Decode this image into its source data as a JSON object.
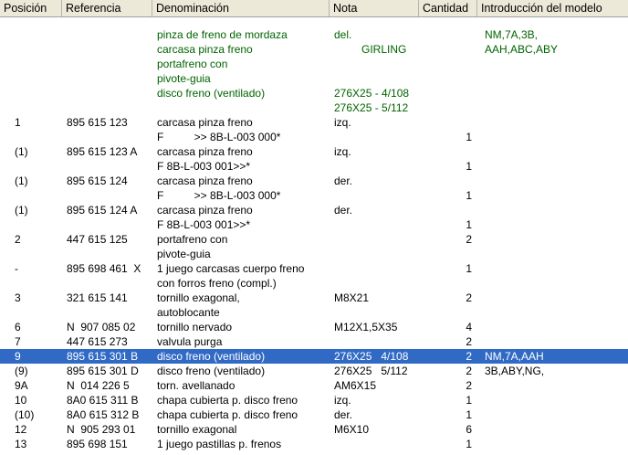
{
  "columns": [
    "Posición",
    "Referencia",
    "Denominación",
    "Nota",
    "Cantidad",
    "Introducción del modelo"
  ],
  "selected_row": 18,
  "colors": {
    "group_text": "#006400",
    "selection": "#316ac5",
    "header_bg": "#ece9d8"
  },
  "rows": [
    {
      "pos": "",
      "ref": "",
      "den": "pinza de freno de mordaza",
      "nota": "del.",
      "cant": "",
      "intro": "NM,7A,3B,",
      "group": true
    },
    {
      "pos": "",
      "ref": "",
      "den": "carcasa pinza freno",
      "nota": "         GIRLING",
      "cant": "",
      "intro": "AAH,ABC,ABY",
      "group": true
    },
    {
      "pos": "",
      "ref": "",
      "den": "portafreno con",
      "nota": "",
      "cant": "",
      "intro": "",
      "group": true
    },
    {
      "pos": "",
      "ref": "",
      "den": "pivote-guia",
      "nota": "",
      "cant": "",
      "intro": "",
      "group": true
    },
    {
      "pos": "",
      "ref": "",
      "den": "disco freno (ventilado)",
      "nota": "276X25 - 4/108",
      "cant": "",
      "intro": "",
      "group": true
    },
    {
      "pos": "",
      "ref": "",
      "den": "",
      "nota": "276X25 - 5/112",
      "cant": "",
      "intro": "",
      "group": true
    },
    {
      "pos": "1",
      "ref": "895 615 123",
      "den": "carcasa pinza freno",
      "nota": "izq.",
      "cant": "",
      "intro": ""
    },
    {
      "pos": "",
      "ref": "",
      "den": "F          >> 8B-L-003 000*",
      "nota": "",
      "cant": "1",
      "intro": ""
    },
    {
      "pos": "(1)",
      "ref": "895 615 123 A",
      "den": "carcasa pinza freno",
      "nota": "izq.",
      "cant": "",
      "intro": ""
    },
    {
      "pos": "",
      "ref": "",
      "den": "F 8B-L-003 001>>*",
      "nota": "",
      "cant": "1",
      "intro": ""
    },
    {
      "pos": "(1)",
      "ref": "895 615 124",
      "den": "carcasa pinza freno",
      "nota": "der.",
      "cant": "",
      "intro": ""
    },
    {
      "pos": "",
      "ref": "",
      "den": "F          >> 8B-L-003 000*",
      "nota": "",
      "cant": "1",
      "intro": ""
    },
    {
      "pos": "(1)",
      "ref": "895 615 124 A",
      "den": "carcasa pinza freno",
      "nota": "der.",
      "cant": "",
      "intro": ""
    },
    {
      "pos": "",
      "ref": "",
      "den": "F 8B-L-003 001>>*",
      "nota": "",
      "cant": "1",
      "intro": ""
    },
    {
      "pos": "2",
      "ref": "447 615 125",
      "den": "portafreno con",
      "nota": "",
      "cant": "2",
      "intro": ""
    },
    {
      "pos": "",
      "ref": "",
      "den": "pivote-guia",
      "nota": "",
      "cant": "",
      "intro": ""
    },
    {
      "pos": "-",
      "ref": "895 698 461  X",
      "den": "1 juego carcasas cuerpo freno",
      "nota": "",
      "cant": "1",
      "intro": ""
    },
    {
      "pos": "",
      "ref": "",
      "den": "con forros freno (compl.)",
      "nota": "",
      "cant": "",
      "intro": ""
    },
    {
      "pos": "3",
      "ref": "321 615 141",
      "den": "tornillo exagonal,",
      "nota": "M8X21",
      "cant": "2",
      "intro": ""
    },
    {
      "pos": "",
      "ref": "",
      "den": "autoblocante",
      "nota": "",
      "cant": "",
      "intro": ""
    },
    {
      "pos": "6",
      "ref": "N  907 085 02",
      "den": "tornillo nervado",
      "nota": "M12X1,5X35",
      "cant": "4",
      "intro": ""
    },
    {
      "pos": "7",
      "ref": "447 615 273",
      "den": "valvula purga",
      "nota": "",
      "cant": "2",
      "intro": ""
    },
    {
      "pos": "9",
      "ref": "895 615 301 B",
      "den": "disco freno (ventilado)",
      "nota": "276X25   4/108",
      "cant": "2",
      "intro": "NM,7A,AAH",
      "selected": true
    },
    {
      "pos": "(9)",
      "ref": "895 615 301 D",
      "den": "disco freno (ventilado)",
      "nota": "276X25   5/112",
      "cant": "2",
      "intro": "3B,ABY,NG,"
    },
    {
      "pos": "9A",
      "ref": "N  014 226 5",
      "den": "torn. avellanado",
      "nota": "AM6X15",
      "cant": "2",
      "intro": ""
    },
    {
      "pos": "10",
      "ref": "8A0 615 311 B",
      "den": "chapa cubierta p. disco freno",
      "nota": "izq.",
      "cant": "1",
      "intro": ""
    },
    {
      "pos": "(10)",
      "ref": "8A0 615 312 B",
      "den": "chapa cubierta p. disco freno",
      "nota": "der.",
      "cant": "1",
      "intro": ""
    },
    {
      "pos": "12",
      "ref": "N  905 293 01",
      "den": "tornillo exagonal",
      "nota": "M6X10",
      "cant": "6",
      "intro": ""
    },
    {
      "pos": "13",
      "ref": "895 698 151",
      "den": "1 juego pastillas p. frenos",
      "nota": "",
      "cant": "1",
      "intro": ""
    }
  ]
}
